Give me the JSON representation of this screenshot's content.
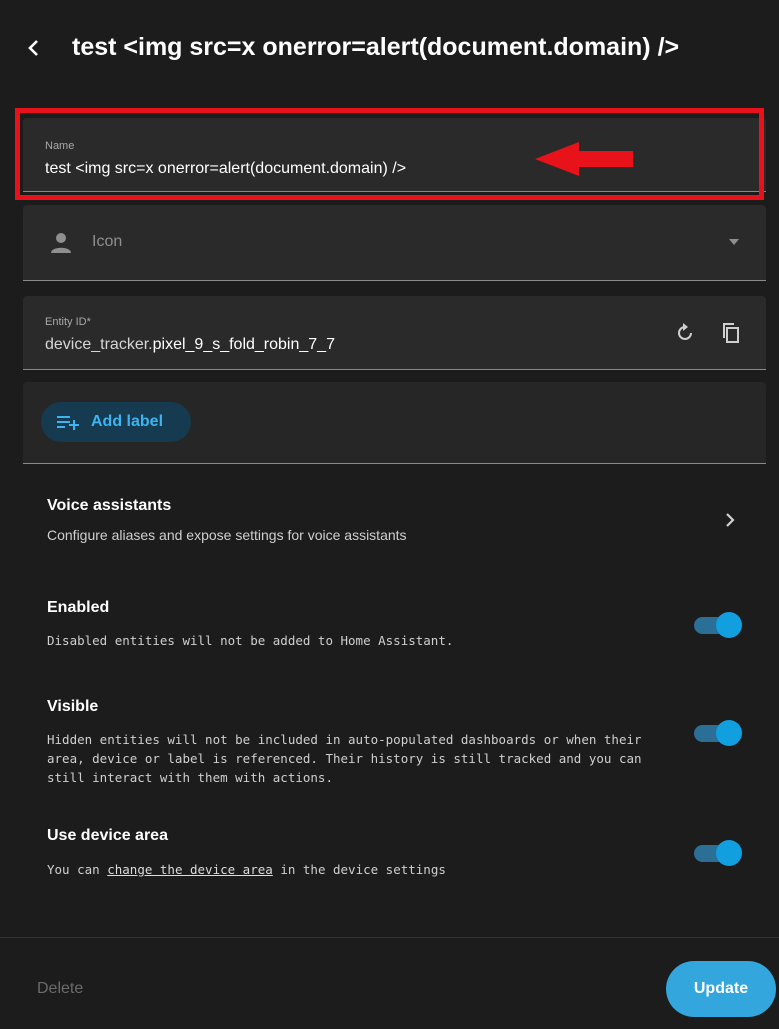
{
  "header": {
    "title": "test <img src=x onerror=alert(document.domain) />"
  },
  "name_field": {
    "label": "Name",
    "value": "test <img src=x onerror=alert(document.domain) />"
  },
  "icon_field": {
    "icon": "account-icon",
    "placeholder": "Icon",
    "dropdown_icon": "menu-down-icon"
  },
  "entity_field": {
    "label": "Entity ID*",
    "value_prefix": "device_tracker.",
    "value_suffix": "pixel_9_s_fold_robin_7_7",
    "actions": [
      "restore-icon",
      "copy-icon"
    ]
  },
  "labels": {
    "add_label": "Add label"
  },
  "voice": {
    "title": "Voice assistants",
    "description": "Configure aliases and expose settings for voice assistants"
  },
  "enabled": {
    "title": "Enabled",
    "description": "Disabled entities will not be added to Home Assistant.",
    "on": true
  },
  "visible": {
    "title": "Visible",
    "description": "Hidden entities will not be included in auto-populated dashboards or when their area, device or label is referenced. Their history is still tracked and you can still interact with them with actions.",
    "on": true
  },
  "device_area": {
    "title": "Use device area",
    "description_pre": "You can ",
    "link": "change the device area",
    "description_post": " in the device settings",
    "on": true
  },
  "footer": {
    "delete": "Delete",
    "update": "Update"
  },
  "colors": {
    "accent": "#33a6de",
    "highlight": "#e8121a"
  }
}
